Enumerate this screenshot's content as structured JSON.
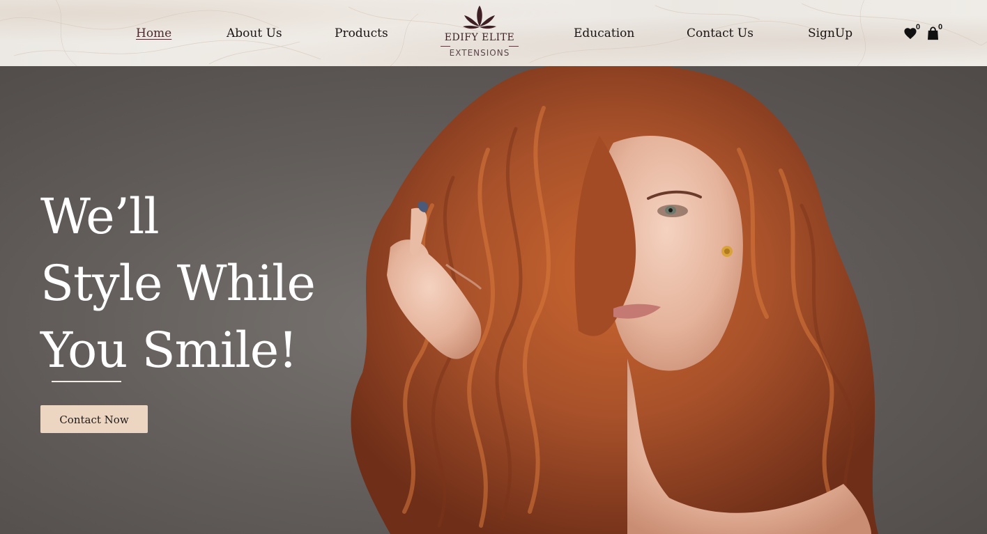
{
  "nav": {
    "items": [
      {
        "label": "Home",
        "active": true
      },
      {
        "label": "About Us"
      },
      {
        "label": "Products"
      },
      {
        "label": "Education"
      },
      {
        "label": "Contact Us"
      },
      {
        "label": "SignUp"
      }
    ]
  },
  "logo": {
    "brand": "EDIFY ELITE",
    "tagline": "EXTENSIONS",
    "icon": "lotus-icon"
  },
  "header_icons": {
    "wishlist": {
      "icon": "heart-icon",
      "count": "0"
    },
    "cart": {
      "icon": "shopping-bag-icon",
      "count": "0"
    }
  },
  "hero": {
    "headline_lines": [
      "We’ll",
      "Style While",
      "You Smile!"
    ],
    "cta_label": "Contact Now"
  },
  "colors": {
    "header_bg": "#efece7",
    "hero_bg": "#625d5a",
    "cta_bg": "#ecd5c1",
    "brand": "#3a1f22",
    "hair": "#a8512a"
  }
}
